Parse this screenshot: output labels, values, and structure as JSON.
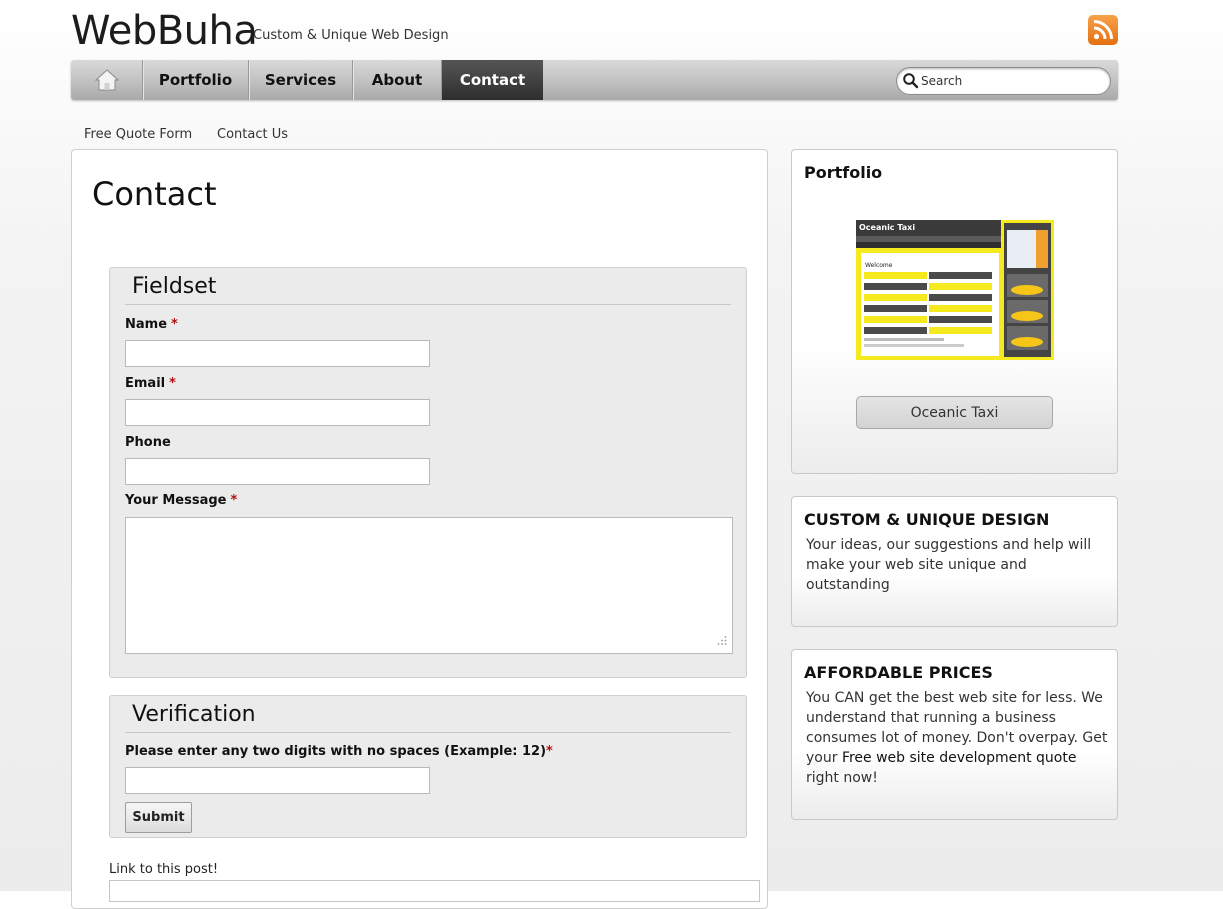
{
  "site": {
    "logo": "WebBuha",
    "tagline": "Custom & Unique Web Design"
  },
  "nav": {
    "items": [
      {
        "label": "Portfolio"
      },
      {
        "label": "Services"
      },
      {
        "label": "About"
      },
      {
        "label": "Contact",
        "active": true
      }
    ],
    "search_placeholder": "Search"
  },
  "subnav": {
    "quote": "Free Quote Form",
    "contact": "Contact Us"
  },
  "main": {
    "title": "Contact",
    "fieldset": {
      "legend": "Fieldset",
      "name_label": "Name",
      "email_label": "Email",
      "phone_label": "Phone",
      "message_label": "Your Message",
      "required_marker": "*"
    },
    "verification": {
      "legend": "Verification",
      "prompt": "Please enter any two digits with no spaces (Example: 12)",
      "submit_label": "Submit"
    },
    "link_label": "Link to this post!"
  },
  "sidebar": {
    "portfolio": {
      "title": "Portfolio",
      "item_button": "Oceanic Taxi",
      "thumb_title": "Oceanic Taxi",
      "thumb_heading": "Welcome"
    },
    "design": {
      "title": "CUSTOM & UNIQUE DESIGN",
      "text": "Your ideas, our suggestions and help will make your web site unique and outstanding"
    },
    "prices": {
      "title": "AFFORDABLE PRICES",
      "text_before": "You CAN get the best web site for less. We understand that running a business consumes lot of money. Don't overpay. Get your ",
      "link": "Free web site development quote",
      "text_after": " right now!"
    }
  },
  "colors": {
    "nav_active": "#3a3a3a",
    "rss": "#f08a24",
    "required": "#b01010",
    "thumb_yellow": "#f5ea1e"
  },
  "icons": {
    "home": "home-icon",
    "rss": "rss-icon",
    "search": "search-icon",
    "resize": "resize-grip-icon"
  }
}
